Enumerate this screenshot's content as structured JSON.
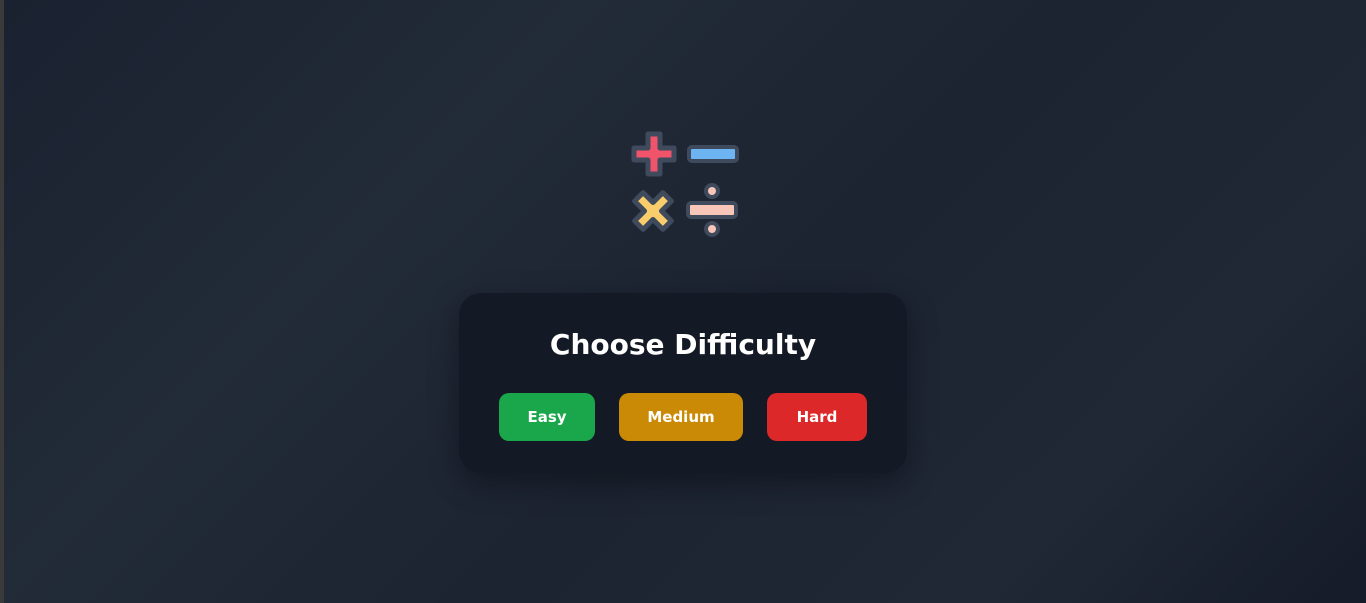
{
  "logo": {
    "icons": [
      "plus-icon",
      "minus-icon",
      "multiply-icon",
      "divide-icon"
    ],
    "colors": {
      "plus": "#f0546a",
      "minus": "#6cb4f2",
      "multiply": "#f9cd6c",
      "divide": "#f8c6b8",
      "outline": "#3f4a5c"
    }
  },
  "difficulty": {
    "title": "Choose Difficulty",
    "buttons": [
      {
        "label": "Easy",
        "color": "#1aa64b"
      },
      {
        "label": "Medium",
        "color": "#cb8a06"
      },
      {
        "label": "Hard",
        "color": "#dc2828"
      }
    ]
  }
}
